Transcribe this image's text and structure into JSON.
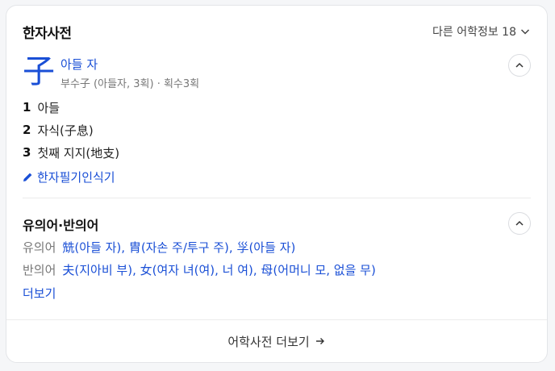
{
  "header": {
    "title": "한자사전",
    "other_info_label": "다른 어학정보 18"
  },
  "entry": {
    "hanja": "子",
    "reading": "아들 자",
    "radical_info": "부수子 (아들자, 3획) · 획수3획"
  },
  "meanings": [
    {
      "num": "1",
      "text": "아들"
    },
    {
      "num": "2",
      "text": "자식(子息)"
    },
    {
      "num": "3",
      "text": "첫째 지지(地支)"
    }
  ],
  "handwriting_label": "한자필기인식기",
  "relations": {
    "title": "유의어·반의어",
    "synonym_label": "유의어",
    "synonyms": "兟(아들 자), 胄(자손 주/투구 주), 㜽(아들 자)",
    "antonym_label": "반의어",
    "antonyms": "夫(지아비 부), 女(여자 녀(여), 너 여), 母(어머니 모, 없을 무)",
    "more_label": "더보기"
  },
  "footer": {
    "label": "어학사전 더보기"
  },
  "colors": {
    "link": "#1a4fd6",
    "muted": "#777777"
  }
}
